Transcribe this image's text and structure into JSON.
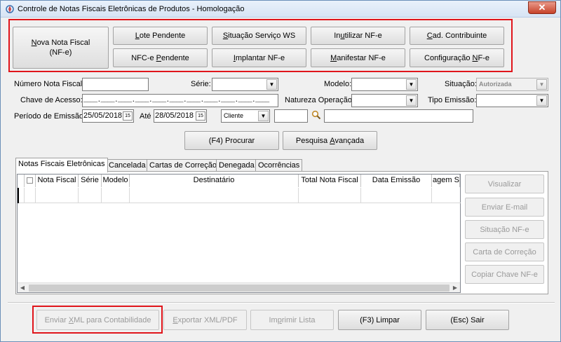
{
  "window": {
    "title": "Controle de Notas Fiscais Eletrônicas de Produtos - Homologação",
    "close_glyph": "✕"
  },
  "toolbar": {
    "nova_nota": {
      "line1": "Nova Nota Fiscal",
      "line1_mnemonic": "N",
      "line1_rest": "ova Nota Fiscal",
      "line2": "(NF-e)"
    },
    "lote_pendente": {
      "mn": "L",
      "rest": "ote Pendente"
    },
    "situacao_servico": {
      "mn": "S",
      "rest": "ituação Serviço WS"
    },
    "inutilizar": {
      "pre": "In",
      "mn": "u",
      "rest": "tilizar NF-e"
    },
    "cad_contribuinte": {
      "mn": "C",
      "rest": "ad. Contribuinte"
    },
    "nfce_pendente": {
      "pre": "NFC-e ",
      "mn": "P",
      "rest": "endente"
    },
    "implantar": {
      "mn": "I",
      "rest": "mplantar NF-e"
    },
    "manifestar": {
      "mn": "M",
      "rest": "anifestar NF-e"
    },
    "configuracao": {
      "pre": "Configuração ",
      "mn": "N",
      "rest": "F-e"
    }
  },
  "filters": {
    "numero_label": "Número Nota Fiscal:",
    "serie_label": "Série:",
    "modelo_label": "Modelo:",
    "situacao_label": "Situação:",
    "situacao_value": "Autorizada",
    "chave_label": "Chave de Acesso:",
    "chave_mask": "____.____.____.____.____.____.____.____.____.____.____",
    "natureza_label": "Natureza Operação:",
    "tipo_emissao_label": "Tipo Emissão:",
    "periodo_label": "Período de Emissão:",
    "date_from": "25/05/2018",
    "ate_label": "Até",
    "date_to": "28/05/2018",
    "calendar_glyph": "15",
    "cliente_value": "Cliente",
    "search_icon": "magnifier-icon"
  },
  "actions": {
    "procurar": "(F4) Procurar",
    "pesquisa_pre": "Pesquisa ",
    "pesquisa_mn": "A",
    "pesquisa_rest": "vançada"
  },
  "tabs": [
    "Notas Fiscais Eletrônicas",
    "Cancelada",
    "Cartas de Correção",
    "Denegada",
    "Ocorrências"
  ],
  "grid": {
    "columns": [
      "",
      "Nota Fiscal",
      "Série",
      "Modelo",
      "Destinatário",
      "Total Nota Fiscal",
      "Data Emissão",
      "agem Sl"
    ]
  },
  "side_buttons": {
    "visualizar": "Visualizar",
    "enviar_email": "Enviar E-mail",
    "situacao_nfe": "Situação NF-e",
    "carta_correcao": "Carta de Correção",
    "copiar_chave": "Copiar Chave NF-e"
  },
  "bottom": {
    "enviar_xml_pre": "Enviar ",
    "enviar_xml_mn": "X",
    "enviar_xml_rest": "ML para Contabilidade",
    "exportar_mn": "E",
    "exportar_rest": "xportar XML/PDF",
    "imprimir_pre": "Im",
    "imprimir_mn": "p",
    "imprimir_rest": "rimir Lista",
    "limpar": "(F3) Limpar",
    "sair": "(Esc) Sair"
  },
  "colors": {
    "highlight": "#e0151b",
    "titlebar": "#d7e4f4",
    "close": "#c7432a"
  }
}
